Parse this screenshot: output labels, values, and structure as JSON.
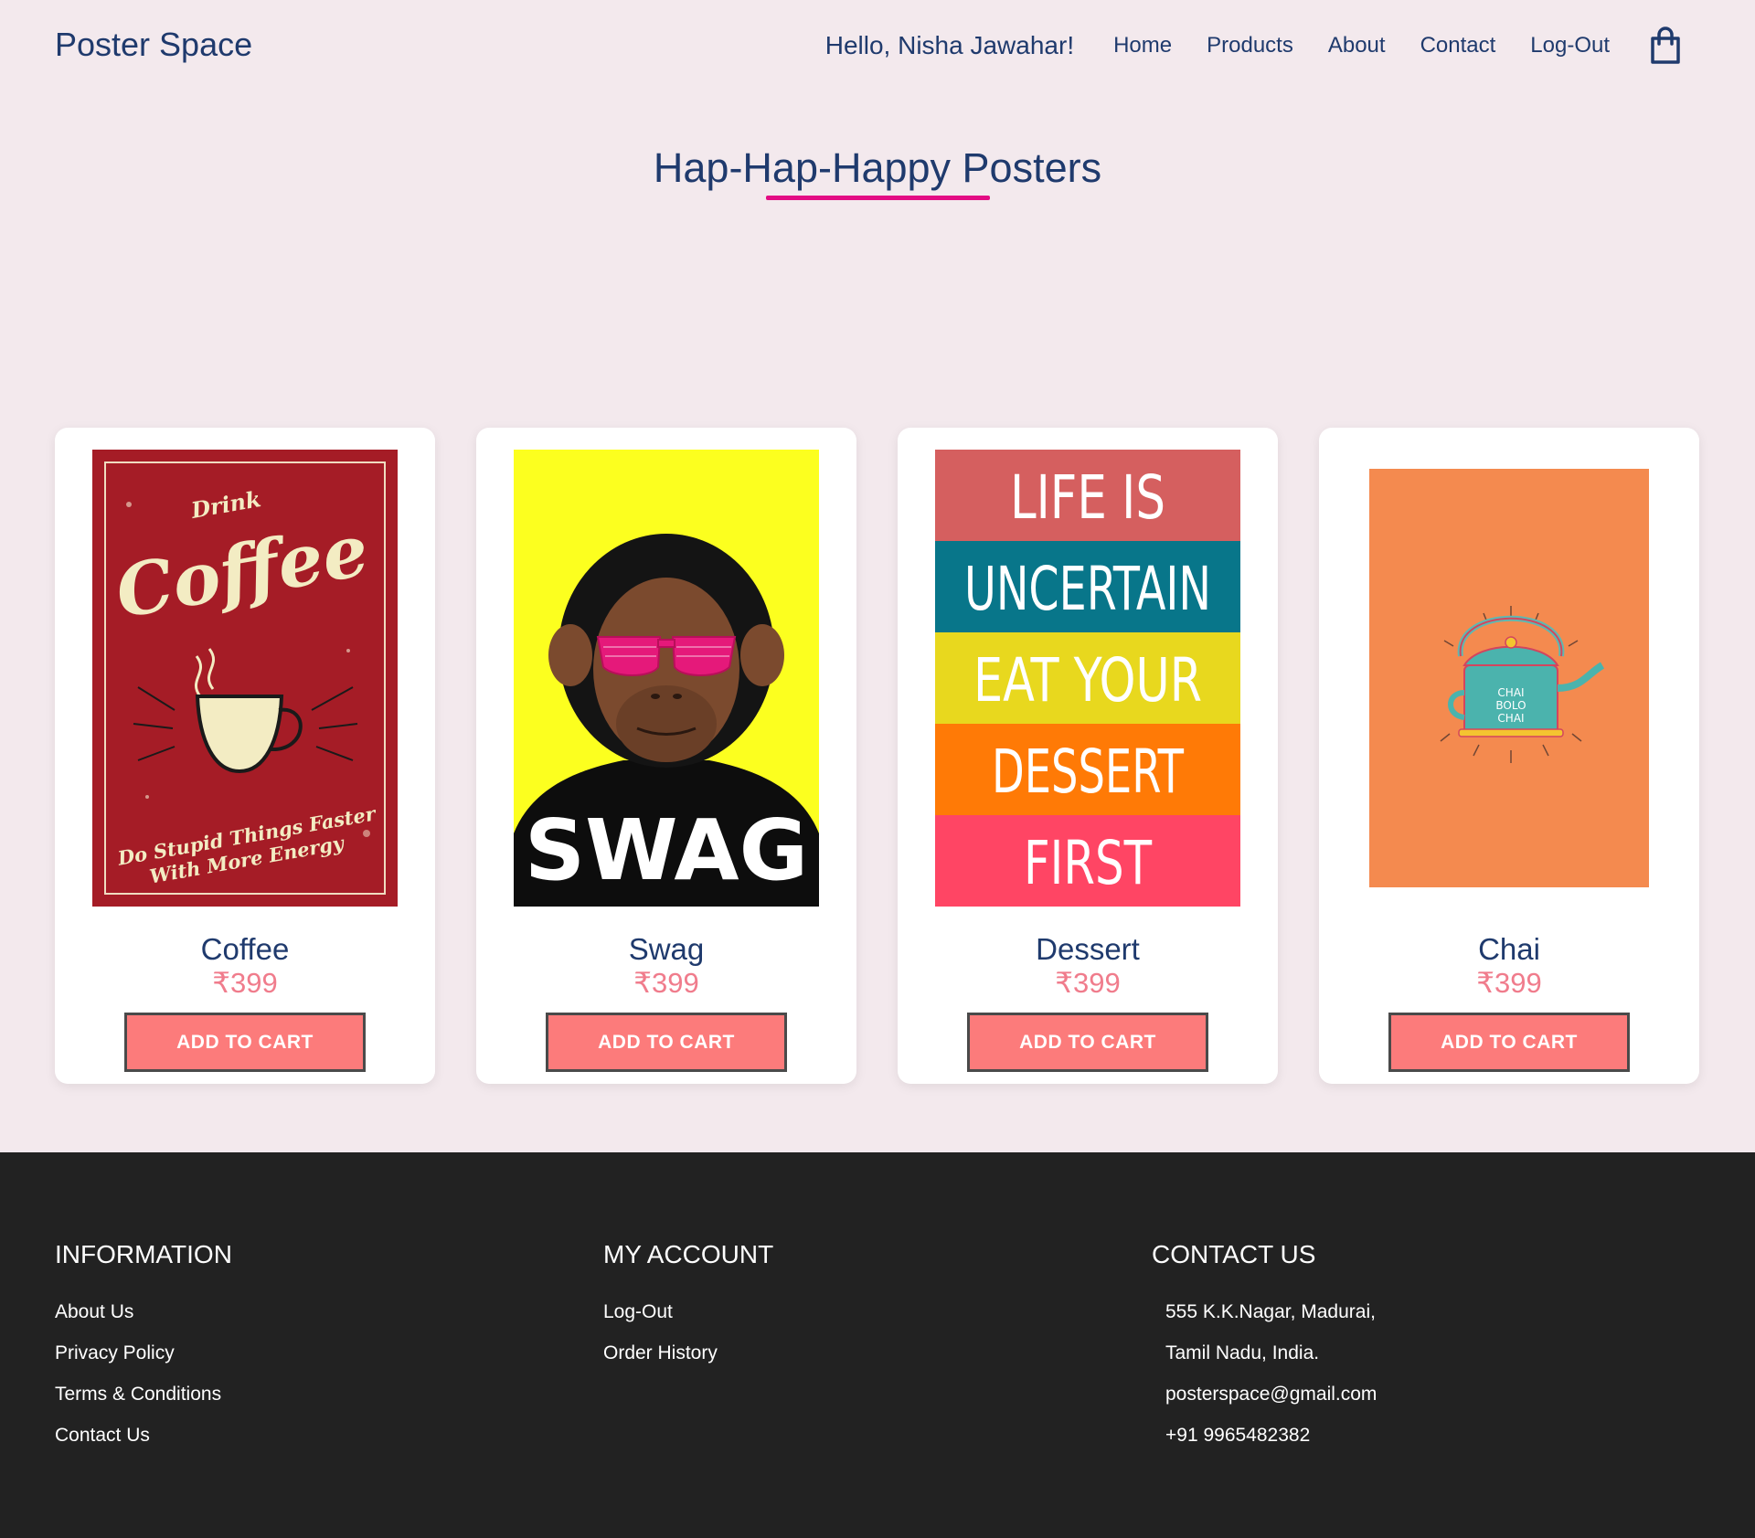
{
  "header": {
    "brand": "Poster Space",
    "greeting": "Hello, Nisha Jawahar!",
    "nav": [
      "Home",
      "Products",
      "About",
      "Contact",
      "Log-Out"
    ]
  },
  "title": "Hap-Hap-Happy Posters",
  "accent_color": "#e30c84",
  "products": [
    {
      "name": "Coffee",
      "price": "₹399",
      "button": "ADD TO CART",
      "poster_text": {
        "small": "Drink",
        "big": "Coffee",
        "line1": "Do Stupid Things Faster",
        "line2": "With More Energy"
      }
    },
    {
      "name": "Swag",
      "price": "₹399",
      "button": "ADD TO CART",
      "poster_text": {
        "big": "SWAG"
      }
    },
    {
      "name": "Dessert",
      "price": "₹399",
      "button": "ADD TO CART",
      "poster_text": {
        "lines": [
          "LIFE IS",
          "UNCERTAIN",
          "EAT YOUR",
          "DESSERT",
          "FIRST"
        ]
      }
    },
    {
      "name": "Chai",
      "price": "₹399",
      "button": "ADD TO CART",
      "poster_text": {
        "lines": [
          "CHAI",
          "BOLO",
          "CHAI"
        ]
      }
    }
  ],
  "footer": {
    "information": {
      "heading": "INFORMATION",
      "links": [
        "About Us",
        "Privacy Policy",
        "Terms & Conditions",
        "Contact Us"
      ]
    },
    "account": {
      "heading": "MY ACCOUNT",
      "links": [
        "Log-Out",
        "Order History"
      ]
    },
    "contact": {
      "heading": "CONTACT US",
      "lines": [
        "555 K.K.Nagar, Madurai,",
        "Tamil Nadu, India.",
        "posterspace@gmail.com",
        "+91 9965482382"
      ]
    }
  }
}
